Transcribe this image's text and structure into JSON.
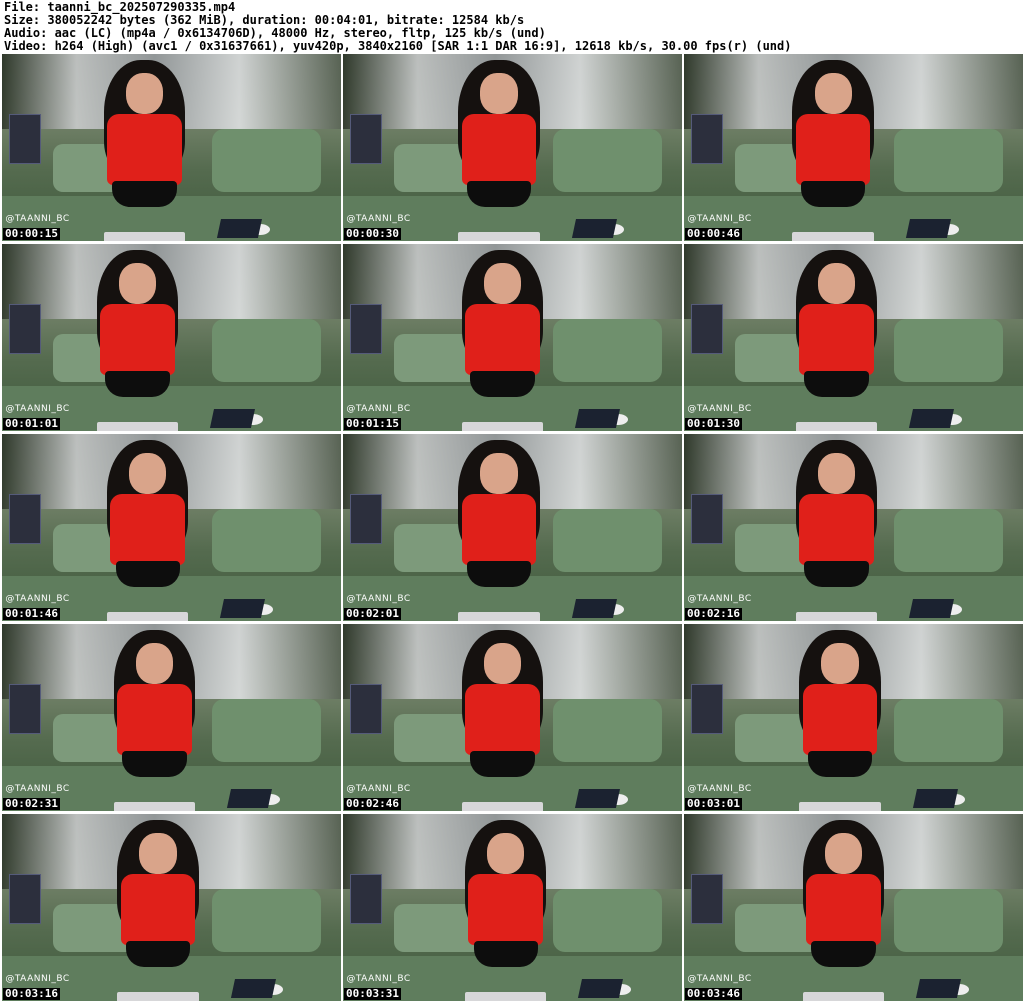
{
  "header": {
    "file": "File: taanni_bc_202507290335.mp4",
    "size": "Size: 380052242 bytes (362 MiB), duration: 00:04:01, bitrate: 12584 kb/s",
    "audio": "Audio: aac (LC) (mp4a / 0x6134706D), 48000 Hz, stereo, fltp, 125 kb/s (und)",
    "video": "Video: h264 (High) (avc1 / 0x31637661), yuv420p, 3840x2160 [SAR 1:1 DAR 16:9], 12618 kb/s, 30.00 fps(r) (und)"
  },
  "watermark": "@TAANNI_BC",
  "thumbnails": [
    {
      "time": "00:00:15"
    },
    {
      "time": "00:00:30"
    },
    {
      "time": "00:00:46"
    },
    {
      "time": "00:01:01"
    },
    {
      "time": "00:01:15"
    },
    {
      "time": "00:01:30"
    },
    {
      "time": "00:01:46"
    },
    {
      "time": "00:02:01"
    },
    {
      "time": "00:02:16"
    },
    {
      "time": "00:02:31"
    },
    {
      "time": "00:02:46"
    },
    {
      "time": "00:03:01"
    },
    {
      "time": "00:03:16"
    },
    {
      "time": "00:03:31"
    },
    {
      "time": "00:03:46"
    }
  ]
}
